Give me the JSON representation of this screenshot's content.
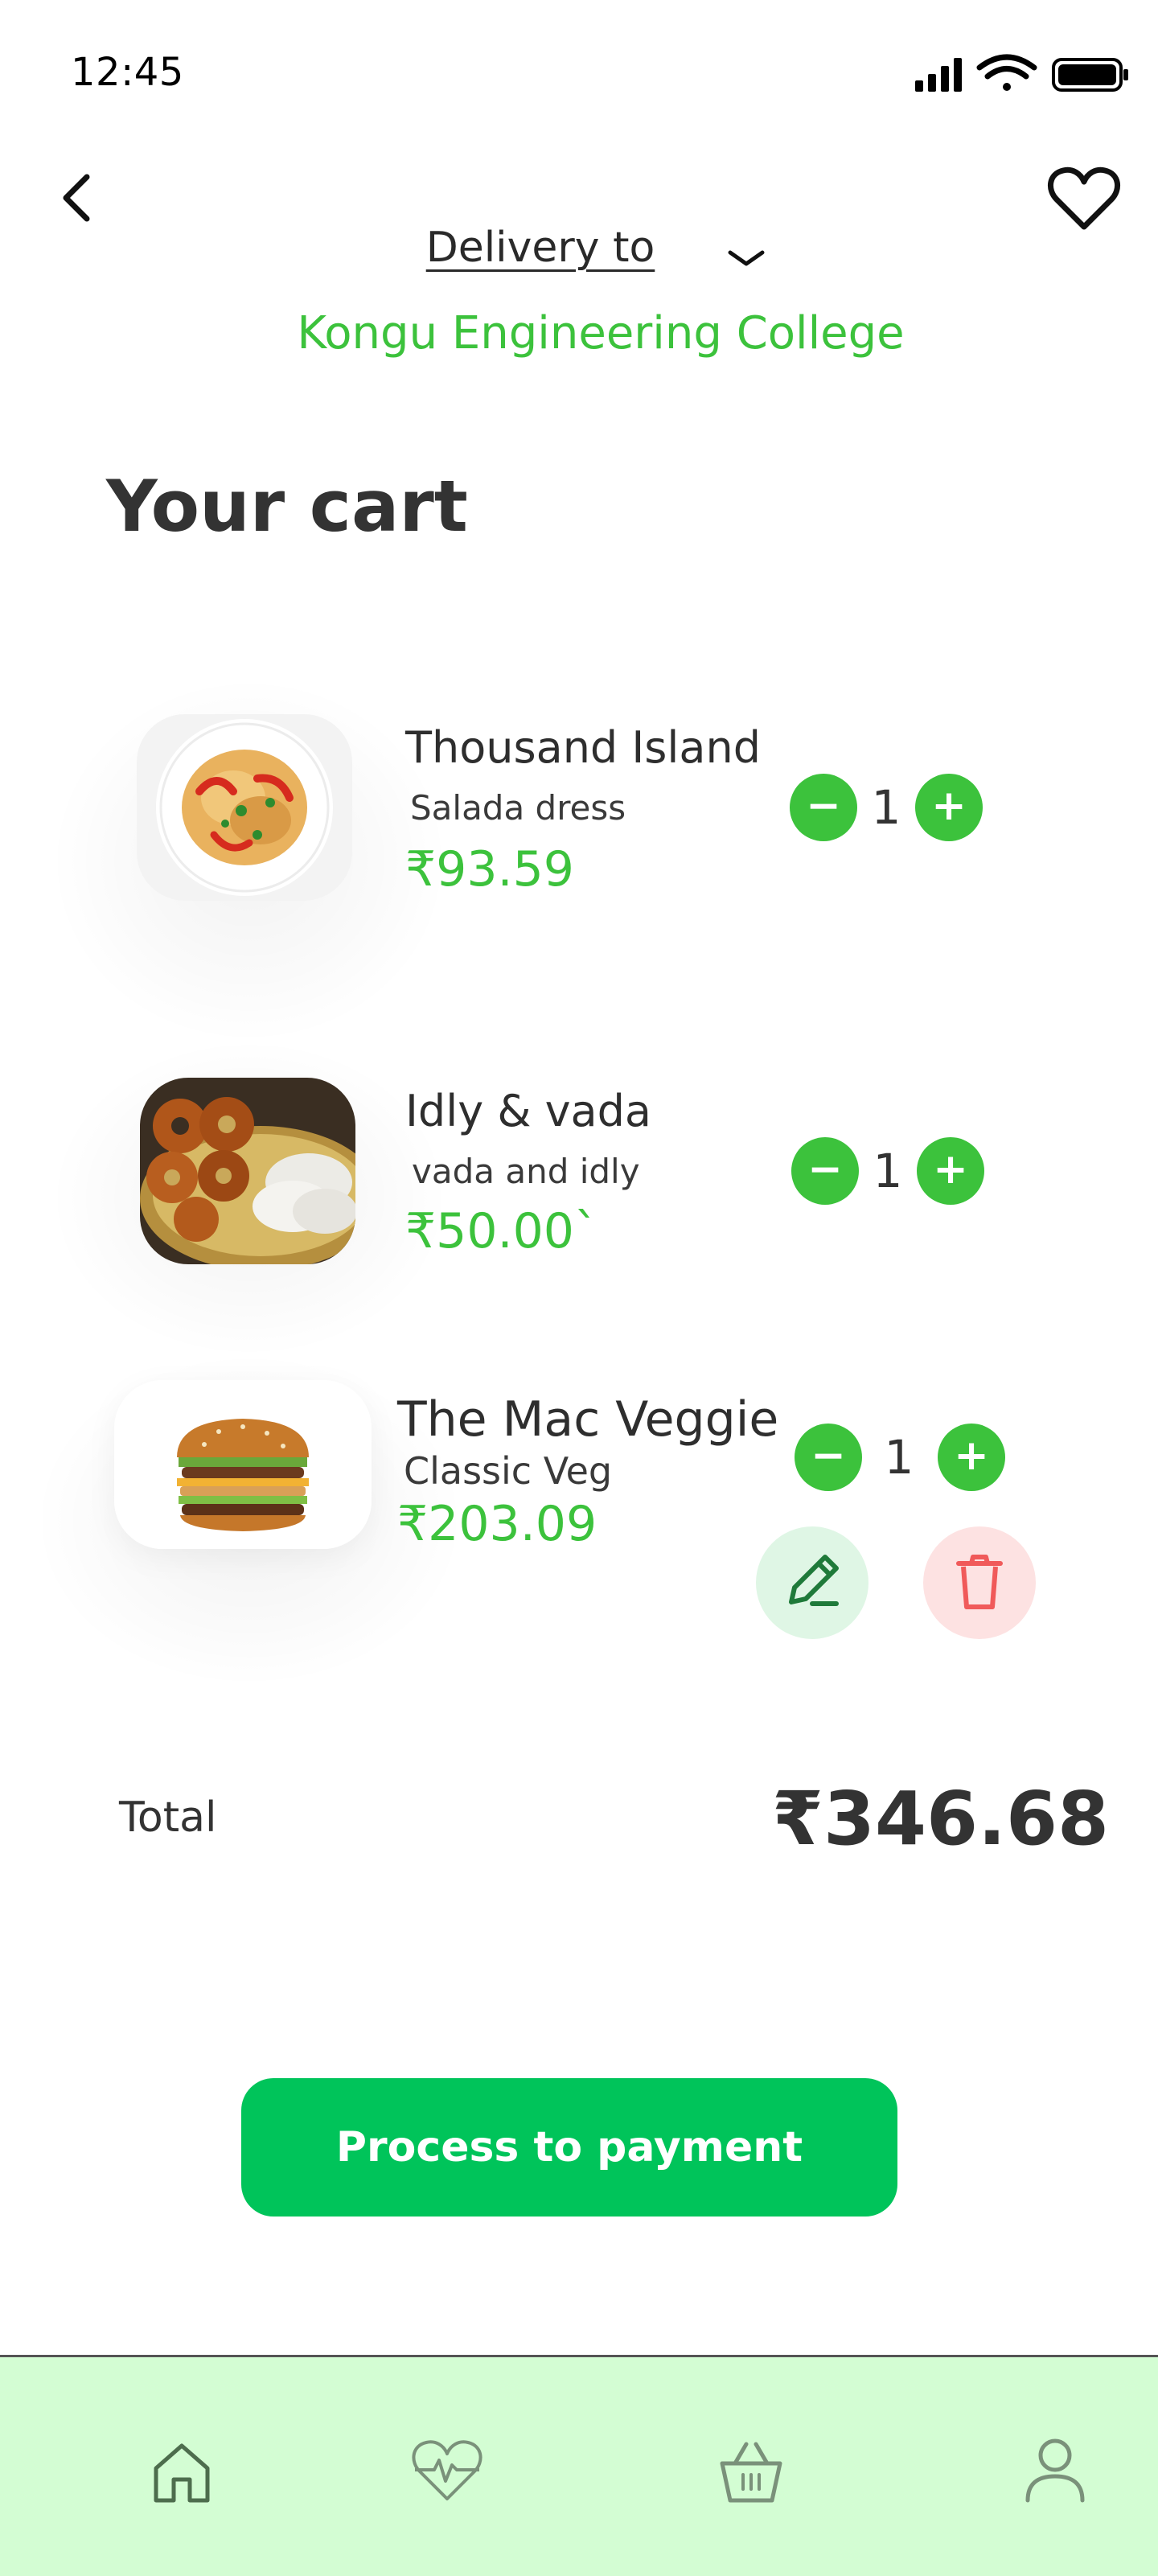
{
  "status_bar": {
    "time": "12:45",
    "icons": [
      "signal-icon",
      "wifi-icon",
      "battery-icon"
    ]
  },
  "header": {
    "back_icon": "chevron-left-icon",
    "favorite_icon": "heart-icon",
    "delivery_label": "Delivery to",
    "delivery_chevron_icon": "chevron-down-icon",
    "delivery_address": "Kongu Engineering College"
  },
  "title": "Your cart",
  "items": [
    {
      "name": "Thousand Island",
      "desc": "Salada dress",
      "price": "₹93.59",
      "qty": "1",
      "image": "salad-plate"
    },
    {
      "name": "Idly & vada",
      "desc": "vada and idly",
      "price": "₹50.00`",
      "qty": "1",
      "image": "idly-vada-plate"
    },
    {
      "name": "The Mac Veggie",
      "desc": "Classic Veg",
      "price": "₹203.09",
      "qty": "1",
      "image": "burger"
    }
  ],
  "qty_controls": {
    "minus": "−",
    "plus": "+"
  },
  "item_actions": {
    "edit_icon": "pencil-icon",
    "delete_icon": "trash-icon"
  },
  "total": {
    "label": "Total",
    "value": "₹346.68"
  },
  "payment_button": "Process to payment",
  "bottom_nav": [
    {
      "icon": "home-icon"
    },
    {
      "icon": "heart-pulse-icon"
    },
    {
      "icon": "basket-icon"
    },
    {
      "icon": "user-icon"
    }
  ],
  "colors": {
    "accent": "#3cc23c",
    "pay_button": "#00c45a",
    "nav_background": "#d3fdd3",
    "edit_bg": "#dff6e5",
    "delete_bg": "#fde2e2",
    "delete_icon": "#f05a5a"
  }
}
